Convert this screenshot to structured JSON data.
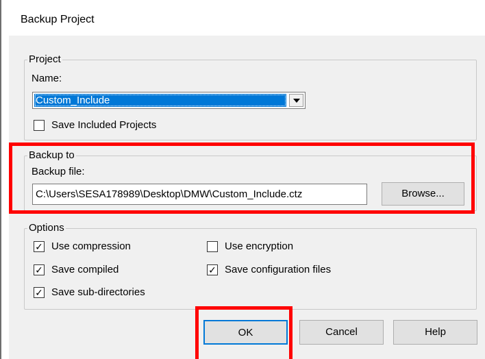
{
  "dialog": {
    "title": "Backup Project"
  },
  "project": {
    "legend": "Project",
    "name_label": "Name:",
    "name_value": "Custom_Include",
    "save_included": {
      "label": "Save Included Projects",
      "checked": false
    }
  },
  "backup": {
    "legend": "Backup to",
    "file_label": "Backup file:",
    "file_value": "C:\\Users\\SESA178989\\Desktop\\DMW\\Custom_Include.ctz",
    "browse_label": "Browse..."
  },
  "options": {
    "legend": "Options",
    "use_compression": {
      "label": "Use compression",
      "checked": true,
      "mark": "✓"
    },
    "use_encryption": {
      "label": "Use encryption",
      "checked": false,
      "mark": ""
    },
    "save_compiled": {
      "label": "Save compiled",
      "checked": true,
      "mark": "✓"
    },
    "save_config": {
      "label": "Save configuration files",
      "checked": true,
      "mark": "✓"
    },
    "save_subdirs": {
      "label": "Save sub-directories",
      "checked": true,
      "mark": "✓"
    }
  },
  "buttons": {
    "ok": "OK",
    "cancel": "Cancel",
    "help": "Help"
  },
  "highlight_color": "#ff0000"
}
